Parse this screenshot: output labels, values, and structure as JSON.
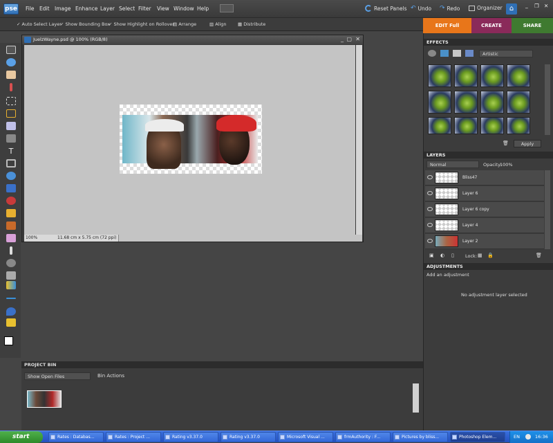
{
  "app": {
    "logo": "pse"
  },
  "menu": [
    "File",
    "Edit",
    "Image",
    "Enhance",
    "Layer",
    "Select",
    "Filter",
    "View",
    "Window",
    "Help"
  ],
  "toolbar": {
    "reset_panels": "Reset Panels",
    "undo": "Undo",
    "redo": "Redo",
    "organizer": "Organizer"
  },
  "window_controls": {
    "minimize": "_",
    "restore": "❐",
    "close": "✕"
  },
  "options": {
    "auto_select": "Auto Select Layer",
    "show_bbox": "Show Bounding Box",
    "show_highlight": "Show Highlight on Rollover",
    "arrange": "Arrange",
    "align": "Align",
    "distribute": "Distribute"
  },
  "modes": {
    "edit": "EDIT Full",
    "create": "CREATE",
    "share": "SHARE"
  },
  "document": {
    "title": "JuelzWayne.psd @ 100% (RGB/8)",
    "zoom": "100%",
    "size": "11.68 cm x 5.75 cm (72 ppi)"
  },
  "effects": {
    "header": "EFFECTS",
    "dropdown": "Artistic",
    "apply": "Apply"
  },
  "layers": {
    "header": "LAYERS",
    "blend": "Normal",
    "opacity_label": "Opacity:",
    "opacity": "100%",
    "lock": "Lock:",
    "items": [
      {
        "name": "Bliss47"
      },
      {
        "name": "Layer 6"
      },
      {
        "name": "Layer 6 copy"
      },
      {
        "name": "Layer 4"
      },
      {
        "name": "Layer 2"
      }
    ]
  },
  "adjustments": {
    "header": "ADJUSTMENTS",
    "add": "Add an adjustment",
    "empty": "No adjustment layer selected"
  },
  "project_bin": {
    "header": "PROJECT BIN",
    "filter": "Show Open Files",
    "actions": "Bin Actions"
  },
  "taskbar": {
    "start": "start",
    "tasks": [
      "Rates : Databas...",
      "Rates : Project ...",
      "Rating v3.37.0",
      "Rating v3.37.0",
      "Microsoft Visual ...",
      "frmAuthority : F...",
      "Pictures by bliss...",
      "Photoshop Elem..."
    ],
    "lang": "EN",
    "time": "16:36"
  },
  "colors": {
    "edit_tab": "#e8761a",
    "create_tab": "#8a2a5a",
    "share_tab": "#3f7a30",
    "accent": "#5aa0e6"
  }
}
